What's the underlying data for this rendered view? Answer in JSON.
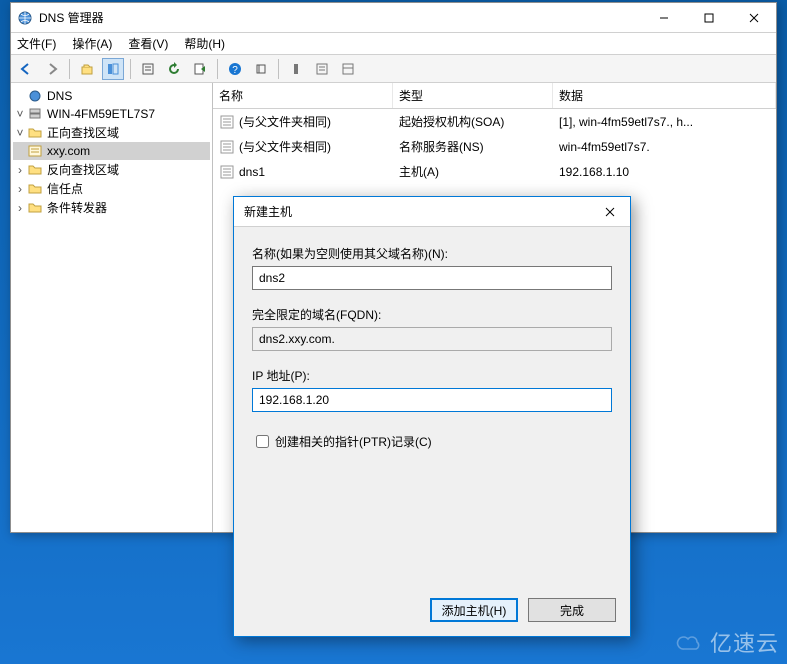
{
  "window": {
    "title": "DNS 管理器"
  },
  "menu": {
    "file": "文件(F)",
    "operate": "操作(A)",
    "view": "查看(V)",
    "help": "帮助(H)"
  },
  "tree": {
    "root": "DNS",
    "server": "WIN-4FM59ETL7S7",
    "fwd_zones": "正向查找区域",
    "zone_xxy": "xxy.com",
    "rev_zones": "反向查找区域",
    "trust_points": "信任点",
    "cond_fwd": "条件转发器"
  },
  "list": {
    "headers": {
      "name": "名称",
      "type": "类型",
      "data": "数据"
    },
    "rows": [
      {
        "name": "(与父文件夹相同)",
        "type": "起始授权机构(SOA)",
        "data": "[1], win-4fm59etl7s7., h..."
      },
      {
        "name": "(与父文件夹相同)",
        "type": "名称服务器(NS)",
        "data": "win-4fm59etl7s7."
      },
      {
        "name": "dns1",
        "type": "主机(A)",
        "data": "192.168.1.10"
      }
    ]
  },
  "dialog": {
    "title": "新建主机",
    "name_label": "名称(如果为空则使用其父域名称)(N):",
    "name_value": "dns2",
    "fqdn_label": "完全限定的域名(FQDN):",
    "fqdn_value": "dns2.xxy.com.",
    "ip_label": "IP 地址(P):",
    "ip_value": "192.168.1.20",
    "ptr_label": "创建相关的指针(PTR)记录(C)",
    "add_btn": "添加主机(H)",
    "done_btn": "完成"
  },
  "watermark": "亿速云"
}
